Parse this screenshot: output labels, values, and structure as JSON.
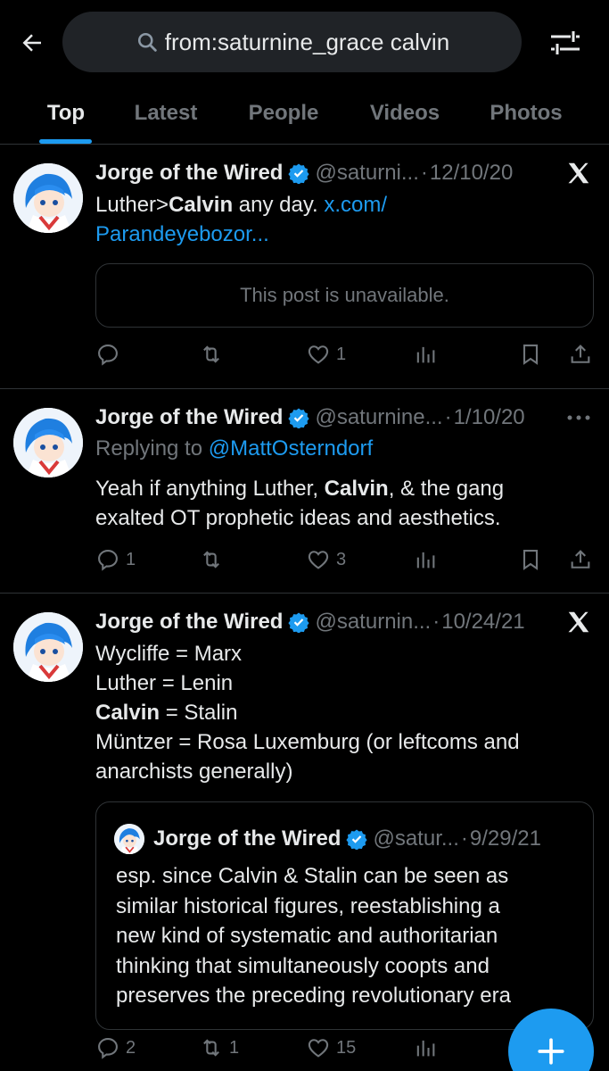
{
  "search": {
    "query": "from:saturnine_grace calvin"
  },
  "tabs": [
    "Top",
    "Latest",
    "People",
    "Videos",
    "Photos"
  ],
  "posts": [
    {
      "name": "Jorge of the Wired",
      "handle": "@saturni...",
      "date": "12/10/20",
      "text_pre": "Luther>",
      "text_bold": "Calvin",
      "text_post": " any day. ",
      "link_line1": "x.com/",
      "link_line2": "Parandeyebozor...",
      "unavailable": "This post is unavailable.",
      "counts": {
        "replies": "",
        "reposts": "",
        "likes": "1"
      }
    },
    {
      "name": "Jorge of the Wired",
      "handle": "@saturnine...",
      "date": "1/10/20",
      "replying_label": "Replying to ",
      "replying_to": "@MattOsterndorf",
      "line1_pre": "Yeah if anything Luther, ",
      "line1_bold": "Calvin",
      "line1_post": ", & the gang",
      "line2": "exalted OT prophetic ideas and aesthetics.",
      "counts": {
        "replies": "1",
        "reposts": "",
        "likes": "3"
      }
    },
    {
      "name": "Jorge of the Wired",
      "handle": "@saturnin...",
      "date": "10/24/21",
      "lines": [
        "Wycliffe = Marx",
        "Luther = Lenin"
      ],
      "line3_bold": "Calvin",
      "line3_post": " = Stalin",
      "line4": "Müntzer = Rosa Luxemburg (or leftcoms and",
      "line5": "anarchists generally)",
      "quote": {
        "name": "Jorge of the Wired",
        "handle": "@satur...",
        "date": "9/29/21",
        "lines": [
          "esp. since Calvin & Stalin can be seen as",
          "similar historical figures, reestablishing a",
          "new kind of systematic and authoritarian",
          "thinking that simultaneously coopts and",
          "preserves the preceding revolutionary era"
        ]
      },
      "counts": {
        "replies": "2",
        "reposts": "1",
        "likes": "15"
      }
    }
  ],
  "dot": "·",
  "colors": {
    "accent": "#1d9bf0",
    "muted": "#71767b",
    "text": "#e7e9ea",
    "border": "#2f3336"
  }
}
